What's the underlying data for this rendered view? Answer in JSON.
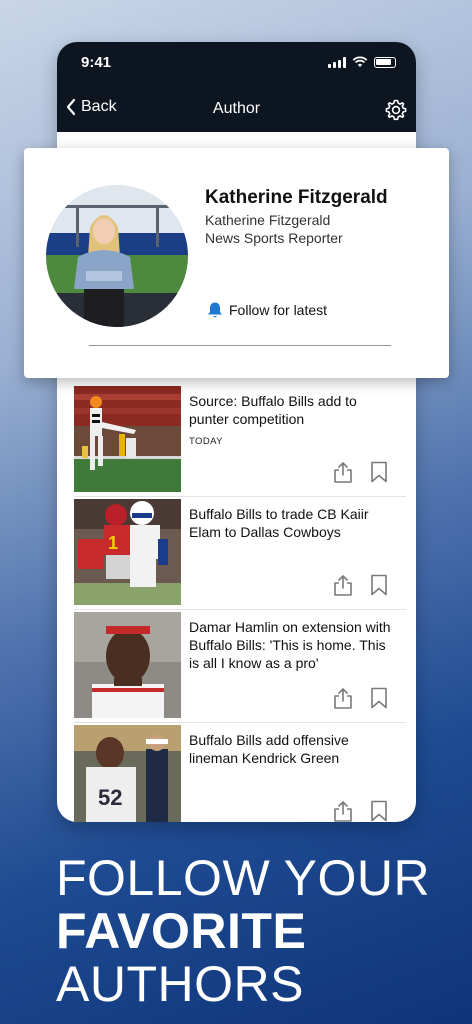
{
  "status_bar": {
    "time": "9:41"
  },
  "nav": {
    "back_label": "Back",
    "title": "Author",
    "back_icon": "chevron-left-icon",
    "settings_icon": "gear-icon"
  },
  "author": {
    "name": "Katherine Fitzgerald",
    "byline": "Katherine Fitzgerald",
    "role": "News Sports Reporter",
    "follow_label": "Follow for latest",
    "follow_icon": "bell-icon"
  },
  "articles": [
    {
      "title": "Source: Buffalo Bills add to punter competition",
      "date": "TODAY"
    },
    {
      "title": "Buffalo Bills to trade CB Kaiir Elam to Dallas Cowboys",
      "date": ""
    },
    {
      "title": "Damar Hamlin on extension with Buffalo Bills: 'This is home. This is all I know as a pro'",
      "date": ""
    },
    {
      "title": "Buffalo Bills add offensive lineman Kendrick Green",
      "date": ""
    }
  ],
  "promo": {
    "line1": "FOLLOW YOUR",
    "line2": "FAVORITE",
    "line3": "AUTHORS"
  },
  "colors": {
    "topbar": "#0d1520",
    "follow_bell": "#1f78d1",
    "promo_bg_bottom": "#0f3479"
  }
}
